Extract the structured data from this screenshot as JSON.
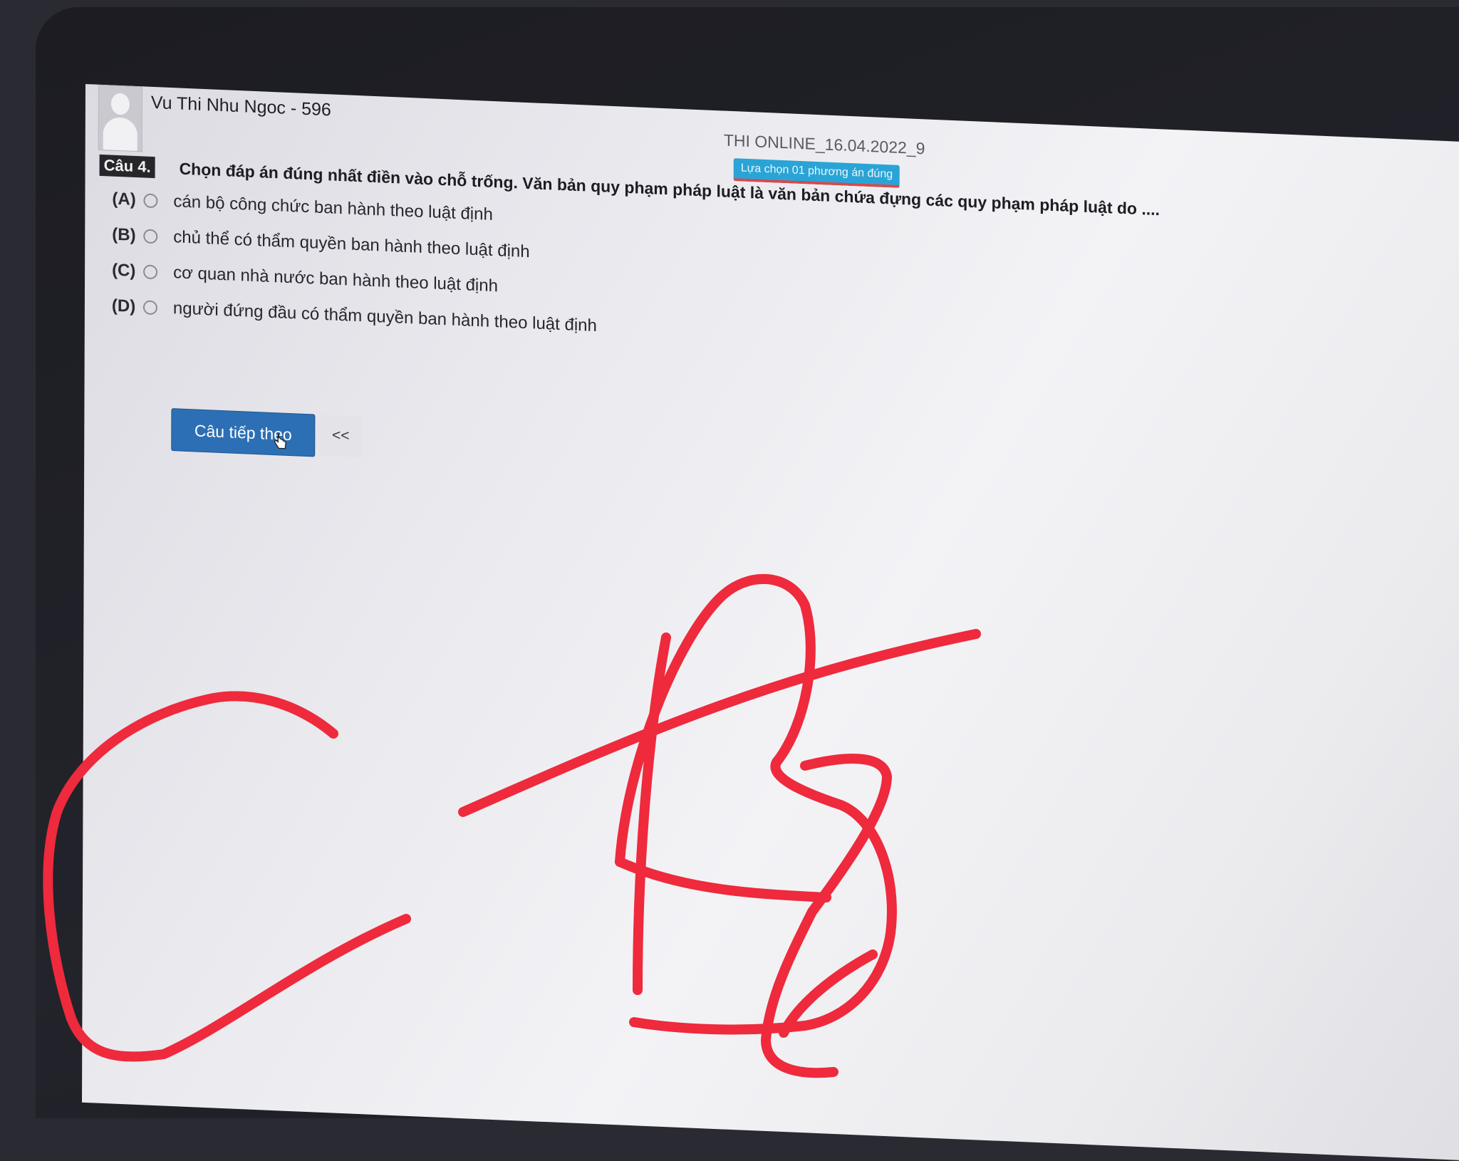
{
  "header": {
    "user_name": "Vu Thi Nhu Ngoc - 596",
    "exam_title": "THI ONLINE_16.04.2022_9",
    "instruction_badge": "Lựa chọn 01 phương án đúng"
  },
  "question": {
    "number_label": "Câu 4.",
    "text": "Chọn đáp án đúng nhất điền vào chỗ trống. Văn bản quy phạm pháp luật là văn bản chứa đựng các quy phạm pháp luật do ....",
    "options": [
      {
        "letter": "(A)",
        "text": "cán bộ công chức ban hành theo luật định"
      },
      {
        "letter": "(B)",
        "text": "chủ thể có thẩm quyền ban hành theo luật định"
      },
      {
        "letter": "(C)",
        "text": "cơ quan nhà nước ban hành theo luật định"
      },
      {
        "letter": "(D)",
        "text": "người đứng đầu có thẩm quyền ban hành theo luật định"
      }
    ]
  },
  "navigation": {
    "next_label": "Câu tiếp theo",
    "prev_label": "<<"
  },
  "colors": {
    "annotation": "#ee2a3c",
    "next_button": "#2c6fb4",
    "badge": "#2aa4d6"
  },
  "icons": {
    "cursor": "hand-pointer-icon",
    "avatar": "user-silhouette-icon"
  }
}
